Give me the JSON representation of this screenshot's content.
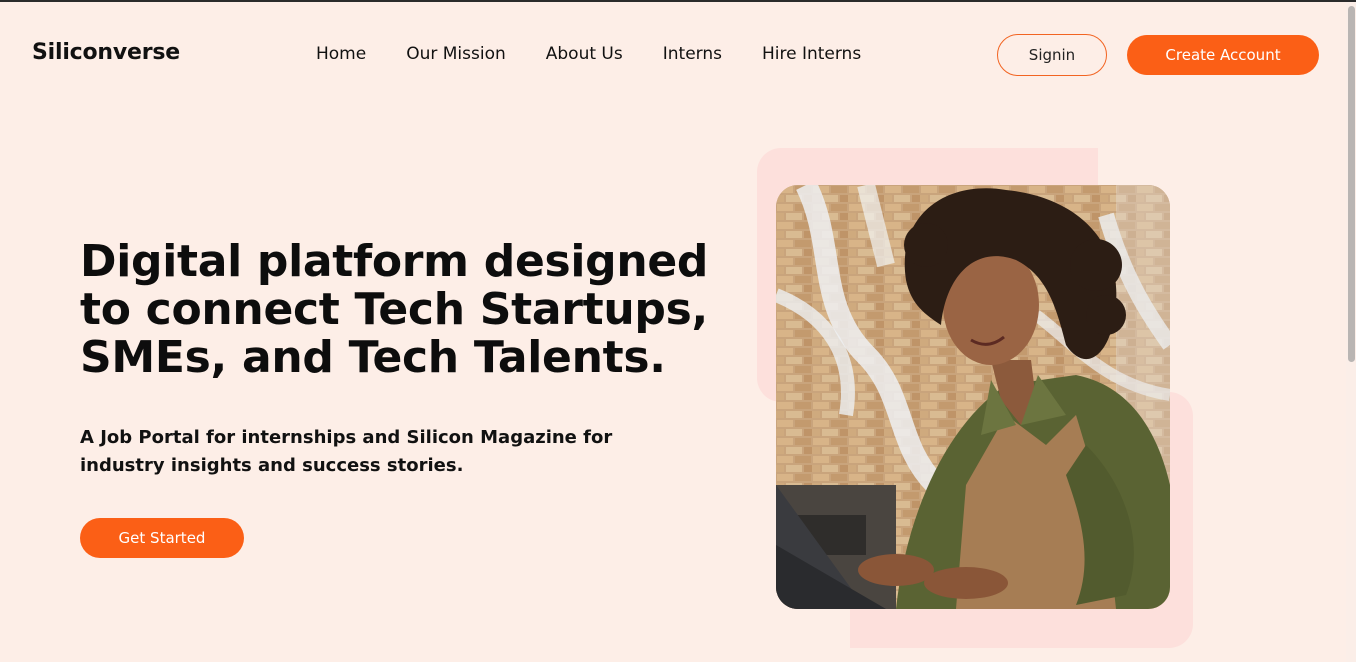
{
  "header": {
    "logo": "Siliconverse",
    "nav": [
      "Home",
      "Our Mission",
      "About Us",
      "Interns",
      "Hire Interns"
    ],
    "signin_label": "Signin",
    "create_label": "Create Account"
  },
  "hero": {
    "title": "Digital platform designed to connect Tech Startups, SMEs, and Tech Talents.",
    "subtitle": "A Job Portal for internships and Silicon Magazine for industry insights and success stories.",
    "cta_label": "Get Started",
    "image_alt": "Woman smiling while typing on a laptop"
  },
  "colors": {
    "background": "#fdeee7",
    "accent": "#fb5f16",
    "decor": "#fde0dc"
  }
}
